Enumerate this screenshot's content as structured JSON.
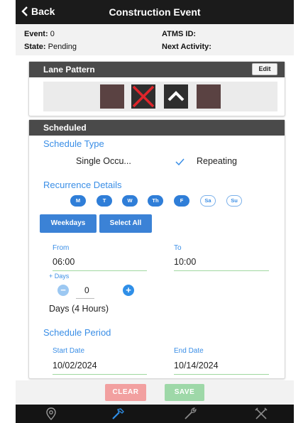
{
  "header": {
    "back_label": "Back",
    "title": "Construction Event"
  },
  "info": {
    "event_label": "Event:",
    "event_value": "0",
    "state_label": "State:",
    "state_value": "Pending",
    "atms_label": "ATMS ID:",
    "atms_value": "",
    "next_label": "Next Activity:",
    "next_value": ""
  },
  "lane_pattern": {
    "title": "Lane Pattern",
    "edit_label": "Edit",
    "lanes": [
      "open",
      "closed",
      "arrow-up",
      "open"
    ]
  },
  "scheduled": {
    "title": "Scheduled",
    "schedule_type_label": "Schedule Type",
    "single_label": "Single Occu...",
    "repeating_label": "Repeating",
    "selected_type": "Repeating",
    "recurrence_label": "Recurrence Details",
    "days": [
      {
        "label": "M",
        "selected": true
      },
      {
        "label": "T",
        "selected": true
      },
      {
        "label": "W",
        "selected": true
      },
      {
        "label": "Th",
        "selected": true
      },
      {
        "label": "F",
        "selected": true
      },
      {
        "label": "Sa",
        "selected": false
      },
      {
        "label": "Su",
        "selected": false
      }
    ],
    "weekdays_label": "Weekdays",
    "select_all_label": "Select All",
    "from_label": "From",
    "from_value": "06:00",
    "to_label": "To",
    "to_value": "10:00",
    "plus_days_label": "+ Days",
    "days_count": "0",
    "duration_text": "Days (4 Hours)",
    "period_label": "Schedule Period",
    "start_label": "Start Date",
    "start_value": "10/02/2024",
    "end_label": "End Date",
    "end_value": "10/14/2024"
  },
  "actions": {
    "clear_label": "CLEAR",
    "save_label": "SAVE"
  },
  "colors": {
    "accent": "#3a8ee6",
    "clear": "#f2a0a0",
    "save": "#9ed8a8",
    "topbar": "#1b1b1b"
  },
  "nav": {
    "icons": [
      "location-pin-icon",
      "hammer-icon",
      "wrench-icon",
      "tools-icon"
    ],
    "active": "hammer-icon"
  }
}
